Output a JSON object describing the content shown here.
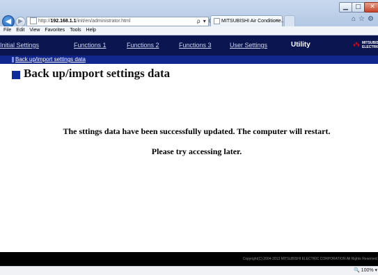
{
  "browser": {
    "address": {
      "prefix": "http://",
      "host": "192.168.1.1",
      "path": "/init/en/administrator.html",
      "tools": "ρ ▾ C ✕"
    },
    "tab_title": "MITSUBISHI Air Conditione...",
    "tab_close": "✕",
    "back_glyph": "◀",
    "forward_glyph": "▶",
    "home_icon": "home-icon",
    "star_icon": "star-icon",
    "gear_icon": "gear-icon",
    "menu": [
      "File",
      "Edit",
      "View",
      "Favorites",
      "Tools",
      "Help"
    ],
    "window_controls": {
      "minimize": "▁",
      "maximize": "□",
      "close": "✕"
    },
    "zoom": "100%"
  },
  "nav": {
    "links": [
      "Initial Settings",
      "Functions 1",
      "Functions 2",
      "Functions 3",
      "User Settings",
      "Utility"
    ],
    "active": "Utility",
    "logo_text": "MITSUBISHI ELECTRIC",
    "sub_link": "Back up/import settings data"
  },
  "content": {
    "heading": "Back up/import settings data",
    "message_line1": "The sttings data have been successfully updated. The computer will restart.",
    "message_line2": "Please try accessing later."
  },
  "footer": {
    "copyright": "Copyright(C) 2004-2013 MITSUBISHI ELECTRIC CORPORATION All Rights Reserved."
  },
  "colors": {
    "nav_bg": "#0b1550",
    "subnav_bg": "#12278d",
    "heading_marker": "#0f2a9c",
    "footer_bg": "#000000"
  }
}
